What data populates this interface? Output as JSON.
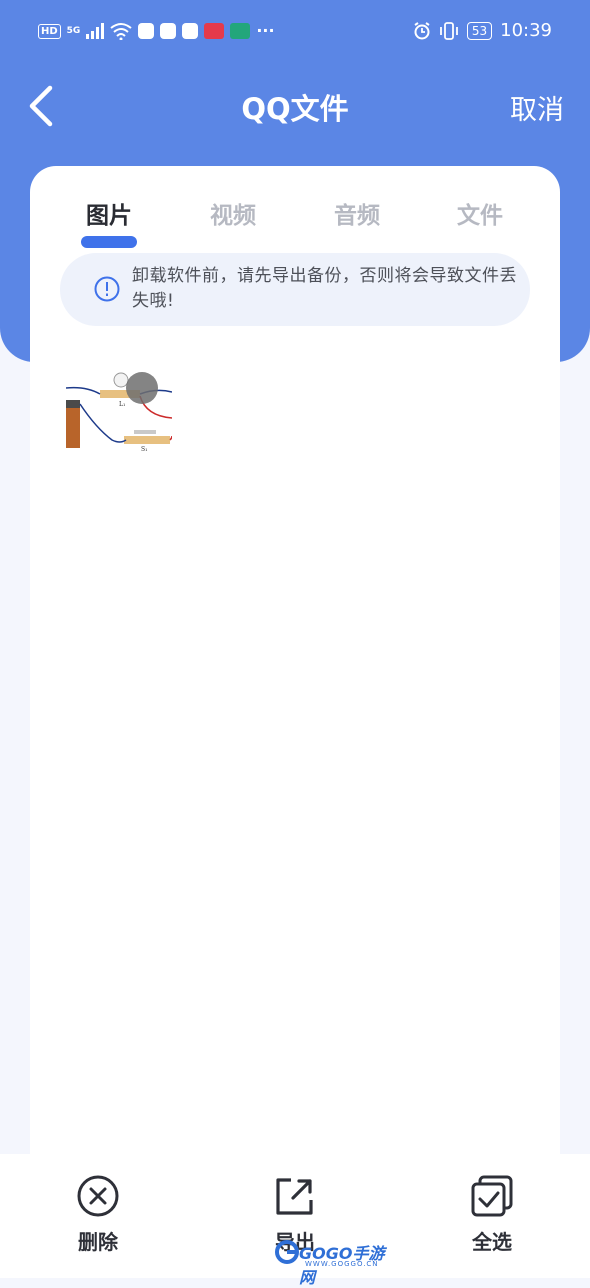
{
  "status_bar": {
    "hd_label": "HD",
    "network_label": "5G",
    "battery": "53",
    "time": "10:39"
  },
  "nav": {
    "title": "QQ文件",
    "cancel_label": "取消"
  },
  "tabs": [
    {
      "label": "图片",
      "active": true
    },
    {
      "label": "视频",
      "active": false
    },
    {
      "label": "音频",
      "active": false
    },
    {
      "label": "文件",
      "active": false
    }
  ],
  "notice": {
    "text": "卸载软件前，请先导出备份，否则将会导致文件丢失哦!"
  },
  "thumbnail": {
    "labels": [
      "L₁",
      "S₁"
    ]
  },
  "actions": {
    "delete_label": "删除",
    "export_label": "导出",
    "select_all_label": "全选"
  },
  "watermark": {
    "text": "GOGO手游网",
    "sub": "WWW.GOGGO.CN"
  },
  "colors": {
    "header_blue": "#5b86e5",
    "accent_blue": "#3f72ea"
  }
}
